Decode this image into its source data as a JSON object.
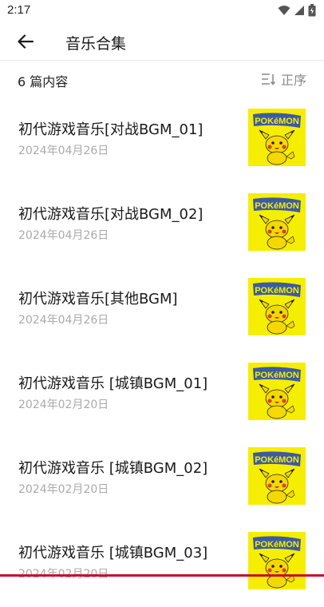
{
  "status": {
    "time": "2:17"
  },
  "header": {
    "title": "音乐合集",
    "back_icon": "arrow-left-icon"
  },
  "list_header": {
    "count": "6 篇内容",
    "sort_label": "正序",
    "sort_icon": "sort-order-icon"
  },
  "items": [
    {
      "title": "初代游戏音乐[对战BGM_01]",
      "date": "2024年04月26日"
    },
    {
      "title": "初代游戏音乐[对战BGM_02]",
      "date": "2024年04月26日"
    },
    {
      "title": "初代游戏音乐[其他BGM]",
      "date": "2024年04月26日"
    },
    {
      "title": "初代游戏音乐 [城镇BGM_01]",
      "date": "2024年02月20日"
    },
    {
      "title": "初代游戏音乐 [城镇BGM_02]",
      "date": "2024年02月20日"
    },
    {
      "title": "初代游戏音乐 [城镇BGM_03]",
      "date": "2024年02月20日"
    }
  ],
  "thumbnail": {
    "logo_text": "POKéMON",
    "background": "#f5ee00"
  },
  "colors": {
    "accent_line": "#c8102e",
    "date_gray": "#aaaaaa",
    "divider": "#ececec"
  }
}
